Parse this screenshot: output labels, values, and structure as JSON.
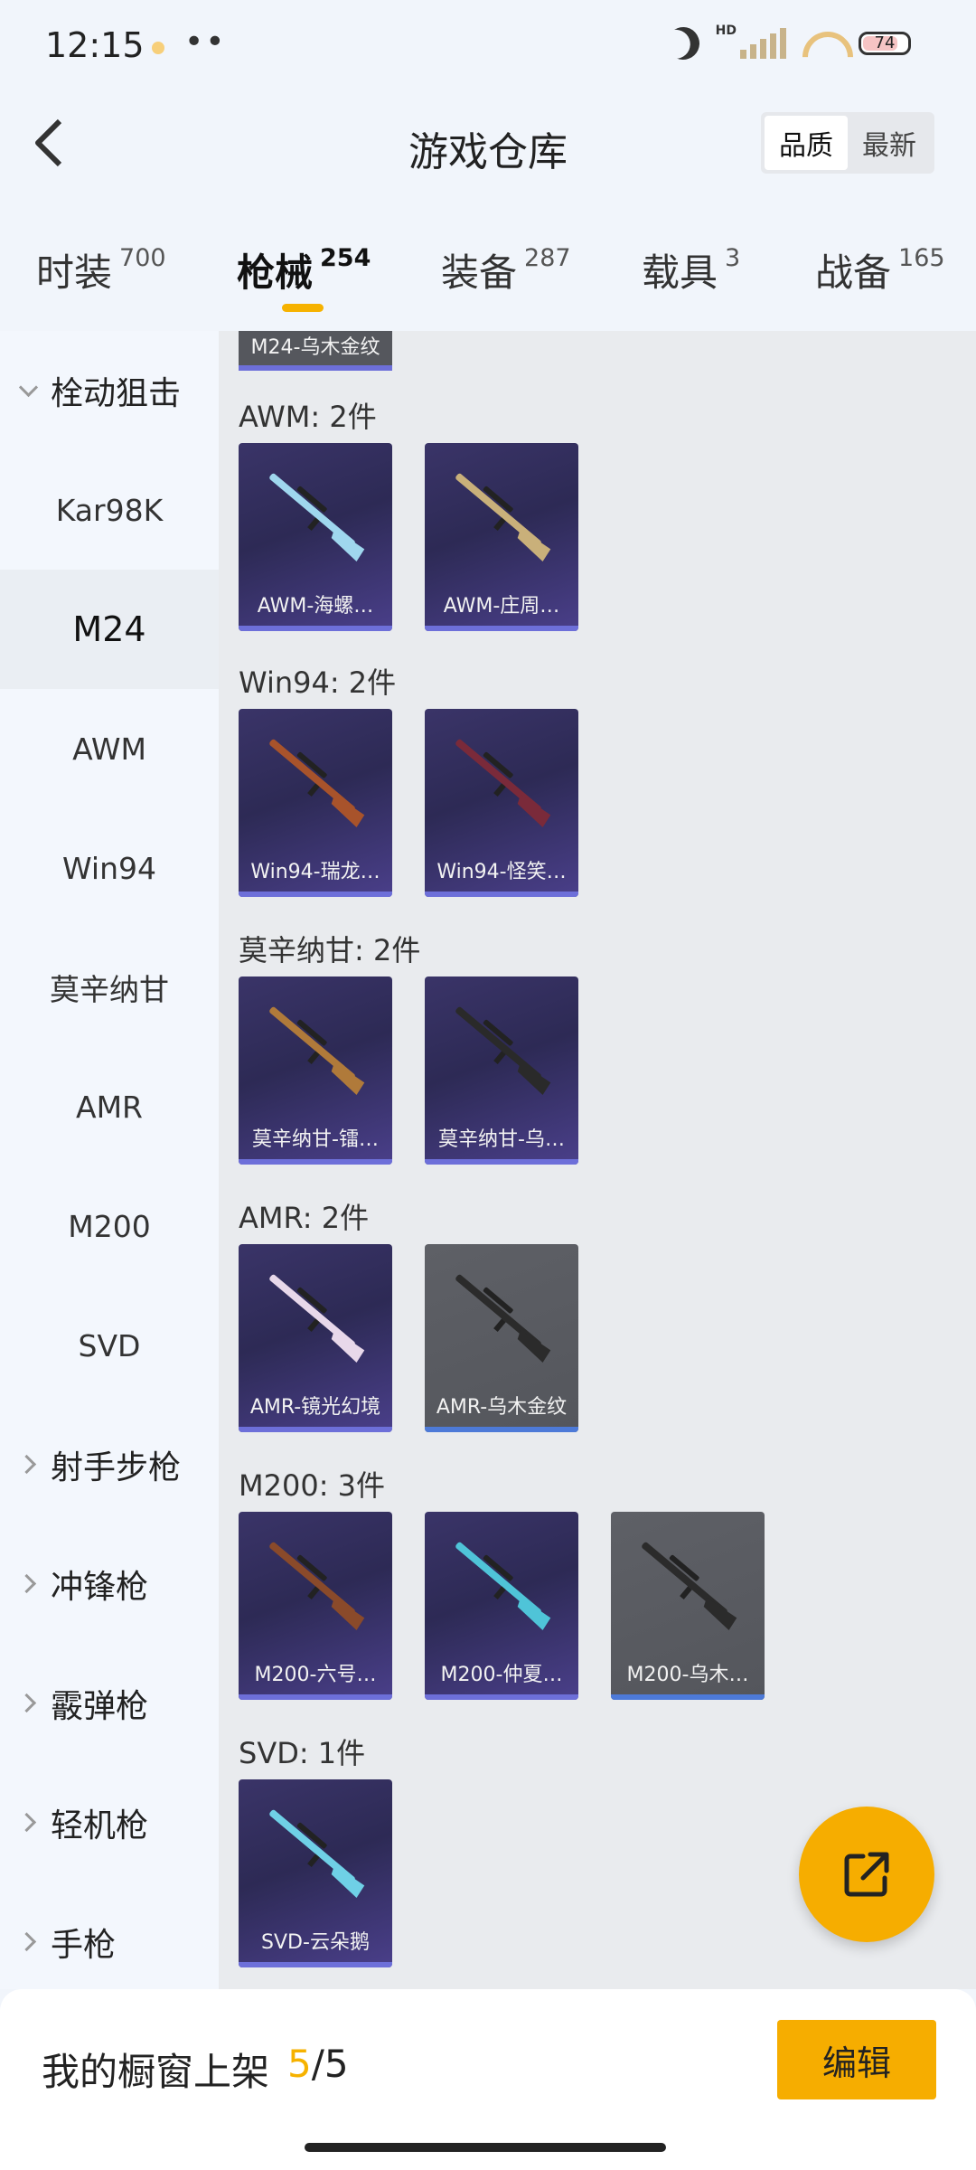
{
  "status_bar": {
    "time": "12:15",
    "hd": "HD",
    "battery": "74"
  },
  "header": {
    "title": "游戏仓库",
    "sort": [
      "品质",
      "最新"
    ],
    "sort_active": 0
  },
  "tabs": [
    {
      "label": "时装",
      "count": "700"
    },
    {
      "label": "枪械",
      "count": "254",
      "active": true
    },
    {
      "label": "装备",
      "count": "287"
    },
    {
      "label": "载具",
      "count": "3"
    },
    {
      "label": "战备",
      "count": "165"
    }
  ],
  "sidebar": {
    "expanded_group": "栓动狙击",
    "items": [
      "Kar98K",
      "M24",
      "AWM",
      "Win94",
      "莫辛纳甘",
      "AMR",
      "M200",
      "SVD"
    ],
    "selected": "M24",
    "groups": [
      "射手步枪",
      "冲锋枪",
      "霰弹枪",
      "轻机枪",
      "手枪"
    ]
  },
  "content": {
    "partial_card": "M24-乌木金纹",
    "sections": [
      {
        "title": "AWM: 2件",
        "items": [
          {
            "name": "AWM-海螺…",
            "style": "purple",
            "gun_color": "#9fd7ee"
          },
          {
            "name": "AWM-庄周…",
            "style": "purple",
            "gun_color": "#c9b07a"
          }
        ]
      },
      {
        "title": "Win94: 2件",
        "items": [
          {
            "name": "Win94-瑞龙…",
            "style": "purple",
            "gun_color": "#a8532b"
          },
          {
            "name": "Win94-怪笑…",
            "style": "purple",
            "gun_color": "#7a2a3a"
          }
        ]
      },
      {
        "title": "莫辛纳甘: 2件",
        "items": [
          {
            "name": "莫辛纳甘-镭…",
            "style": "purple",
            "gun_color": "#b07a3a"
          },
          {
            "name": "莫辛纳甘-乌…",
            "style": "purple",
            "gun_color": "#2a2a2a"
          }
        ]
      },
      {
        "title": "AMR: 2件",
        "items": [
          {
            "name": "AMR-镜光幻境",
            "style": "purple",
            "gun_color": "#e8d8ea"
          },
          {
            "name": "AMR-乌木金纹",
            "style": "grey",
            "gun_color": "#2b2b2b"
          }
        ]
      },
      {
        "title": "M200: 3件",
        "items": [
          {
            "name": "M200-六号…",
            "style": "purple",
            "gun_color": "#8a4a2a"
          },
          {
            "name": "M200-仲夏…",
            "style": "purple",
            "gun_color": "#4fc4d8"
          },
          {
            "name": "M200-乌木…",
            "style": "grey",
            "gun_color": "#2b2b2b"
          }
        ]
      },
      {
        "title": "SVD: 1件",
        "items": [
          {
            "name": "SVD-云朵鹅",
            "style": "purple",
            "gun_color": "#6fd0e6"
          }
        ]
      }
    ]
  },
  "bottom_bar": {
    "label": "我的橱窗上架",
    "current": "5",
    "total": "/5",
    "edit_label": "编辑"
  },
  "colors": {
    "accent": "#f6ad00",
    "card_purple": "#3a3468",
    "card_grey": "#5e6066"
  }
}
